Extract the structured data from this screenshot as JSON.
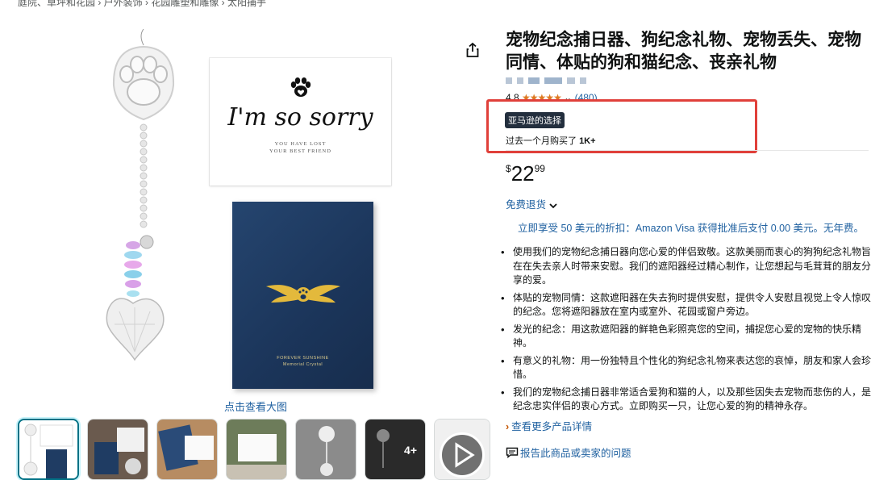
{
  "breadcrumb": "庭院、草坪和花园 › 户外装饰 › 花园雕塑和雕像 › 太阳捕手",
  "gallery": {
    "card_text": "I'm so sorry",
    "card_subtext_1": "YOU HAVE LOST",
    "card_subtext_2": "YOUR BEST FRIEND",
    "box_text_1": "FOREVER SUNSHINE",
    "box_text_2": "Memorial Crystal",
    "view_large_label": "点击查看大图",
    "more_count": "4+"
  },
  "product": {
    "title": "宠物纪念捕日器、狗纪念礼物、宠物丢失、宠物同情、体贴的狗和猫纪念、丧亲礼物",
    "rating_value": "4.8",
    "rating_stars": "★★★★★",
    "rating_count": "(480)",
    "badge": "亚马逊的选择",
    "bought_prefix": "过去一个月购买了",
    "bought_count": "1K+",
    "price_currency": "$",
    "price_whole": "22",
    "price_fraction": "99",
    "returns_label": "免费退货",
    "promo": "立即享受 50 美元的折扣：Amazon Visa 获得批准后支付 0.00 美元。无年费。",
    "bullets": [
      "使用我们的宠物纪念捕日器向您心爱的伴侣致敬。这款美丽而衷心的狗狗纪念礼物旨在在失去亲人时带来安慰。我们的遮阳器经过精心制作，让您想起与毛茸茸的朋友分享的爱。",
      "体贴的宠物同情：这款遮阳器在失去狗时提供安慰，提供令人安慰且视觉上令人惊叹的纪念。您将遮阳器放在室内或室外、花园或窗户旁边。",
      "发光的纪念：用这款遮阳器的鲜艳色彩照亮您的空间，捕捉您心爱的宠物的快乐精神。",
      "有意义的礼物：用一份独特且个性化的狗纪念礼物来表达您的哀悼，朋友和家人会珍惜。",
      "我们的宠物纪念捕日器非常适合爱狗和猫的人，以及那些因失去宠物而悲伤的人，是纪念忠实伴侣的衷心方式。立即购买一只，让您心爱的狗的精神永存。"
    ],
    "more_details_label": "查看更多产品详情",
    "report_label": "报告此商品或卖家的问题"
  },
  "colors": {
    "link": "#2162a1",
    "star": "#de7921",
    "highlight": "#e0403a",
    "badge_bg": "#232f3e",
    "box_navy": "#1b355a"
  }
}
